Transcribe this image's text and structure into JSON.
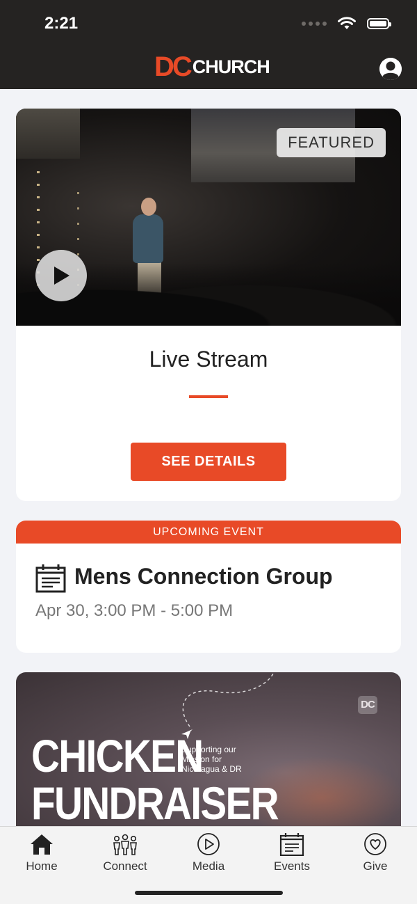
{
  "status_bar": {
    "time": "2:21"
  },
  "header": {
    "logo_dc": "DC",
    "logo_church": "CHURCH"
  },
  "featured": {
    "badge": "FEATURED",
    "title": "Live Stream",
    "button": "SEE DETAILS"
  },
  "event": {
    "header": "UPCOMING EVENT",
    "title": "Mens Connection Group",
    "time": "Apr 30, 3:00 PM - 5:00 PM"
  },
  "promo": {
    "mark": "DC",
    "line1": "CHICKEN",
    "line2": "FUNDRAISER",
    "subtitle": "Supporting our Mission for Nicaragua & DR"
  },
  "tabs": [
    {
      "label": "Home",
      "icon": "home-icon"
    },
    {
      "label": "Connect",
      "icon": "people-icon"
    },
    {
      "label": "Media",
      "icon": "play-circle-icon"
    },
    {
      "label": "Events",
      "icon": "calendar-icon"
    },
    {
      "label": "Give",
      "icon": "heart-circle-icon"
    }
  ],
  "colors": {
    "accent": "#e84a27",
    "header_bg": "#252322",
    "page_bg": "#f2f3f7"
  }
}
